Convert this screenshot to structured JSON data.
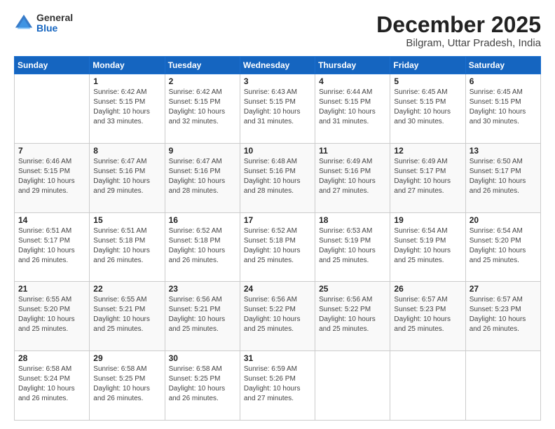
{
  "logo": {
    "general": "General",
    "blue": "Blue"
  },
  "title": "December 2025",
  "subtitle": "Bilgram, Uttar Pradesh, India",
  "days_of_week": [
    "Sunday",
    "Monday",
    "Tuesday",
    "Wednesday",
    "Thursday",
    "Friday",
    "Saturday"
  ],
  "weeks": [
    [
      {
        "day": "",
        "info": ""
      },
      {
        "day": "1",
        "info": "Sunrise: 6:42 AM\nSunset: 5:15 PM\nDaylight: 10 hours\nand 33 minutes."
      },
      {
        "day": "2",
        "info": "Sunrise: 6:42 AM\nSunset: 5:15 PM\nDaylight: 10 hours\nand 32 minutes."
      },
      {
        "day": "3",
        "info": "Sunrise: 6:43 AM\nSunset: 5:15 PM\nDaylight: 10 hours\nand 31 minutes."
      },
      {
        "day": "4",
        "info": "Sunrise: 6:44 AM\nSunset: 5:15 PM\nDaylight: 10 hours\nand 31 minutes."
      },
      {
        "day": "5",
        "info": "Sunrise: 6:45 AM\nSunset: 5:15 PM\nDaylight: 10 hours\nand 30 minutes."
      },
      {
        "day": "6",
        "info": "Sunrise: 6:45 AM\nSunset: 5:15 PM\nDaylight: 10 hours\nand 30 minutes."
      }
    ],
    [
      {
        "day": "7",
        "info": "Sunrise: 6:46 AM\nSunset: 5:15 PM\nDaylight: 10 hours\nand 29 minutes."
      },
      {
        "day": "8",
        "info": "Sunrise: 6:47 AM\nSunset: 5:16 PM\nDaylight: 10 hours\nand 29 minutes."
      },
      {
        "day": "9",
        "info": "Sunrise: 6:47 AM\nSunset: 5:16 PM\nDaylight: 10 hours\nand 28 minutes."
      },
      {
        "day": "10",
        "info": "Sunrise: 6:48 AM\nSunset: 5:16 PM\nDaylight: 10 hours\nand 28 minutes."
      },
      {
        "day": "11",
        "info": "Sunrise: 6:49 AM\nSunset: 5:16 PM\nDaylight: 10 hours\nand 27 minutes."
      },
      {
        "day": "12",
        "info": "Sunrise: 6:49 AM\nSunset: 5:17 PM\nDaylight: 10 hours\nand 27 minutes."
      },
      {
        "day": "13",
        "info": "Sunrise: 6:50 AM\nSunset: 5:17 PM\nDaylight: 10 hours\nand 26 minutes."
      }
    ],
    [
      {
        "day": "14",
        "info": "Sunrise: 6:51 AM\nSunset: 5:17 PM\nDaylight: 10 hours\nand 26 minutes."
      },
      {
        "day": "15",
        "info": "Sunrise: 6:51 AM\nSunset: 5:18 PM\nDaylight: 10 hours\nand 26 minutes."
      },
      {
        "day": "16",
        "info": "Sunrise: 6:52 AM\nSunset: 5:18 PM\nDaylight: 10 hours\nand 26 minutes."
      },
      {
        "day": "17",
        "info": "Sunrise: 6:52 AM\nSunset: 5:18 PM\nDaylight: 10 hours\nand 25 minutes."
      },
      {
        "day": "18",
        "info": "Sunrise: 6:53 AM\nSunset: 5:19 PM\nDaylight: 10 hours\nand 25 minutes."
      },
      {
        "day": "19",
        "info": "Sunrise: 6:54 AM\nSunset: 5:19 PM\nDaylight: 10 hours\nand 25 minutes."
      },
      {
        "day": "20",
        "info": "Sunrise: 6:54 AM\nSunset: 5:20 PM\nDaylight: 10 hours\nand 25 minutes."
      }
    ],
    [
      {
        "day": "21",
        "info": "Sunrise: 6:55 AM\nSunset: 5:20 PM\nDaylight: 10 hours\nand 25 minutes."
      },
      {
        "day": "22",
        "info": "Sunrise: 6:55 AM\nSunset: 5:21 PM\nDaylight: 10 hours\nand 25 minutes."
      },
      {
        "day": "23",
        "info": "Sunrise: 6:56 AM\nSunset: 5:21 PM\nDaylight: 10 hours\nand 25 minutes."
      },
      {
        "day": "24",
        "info": "Sunrise: 6:56 AM\nSunset: 5:22 PM\nDaylight: 10 hours\nand 25 minutes."
      },
      {
        "day": "25",
        "info": "Sunrise: 6:56 AM\nSunset: 5:22 PM\nDaylight: 10 hours\nand 25 minutes."
      },
      {
        "day": "26",
        "info": "Sunrise: 6:57 AM\nSunset: 5:23 PM\nDaylight: 10 hours\nand 25 minutes."
      },
      {
        "day": "27",
        "info": "Sunrise: 6:57 AM\nSunset: 5:23 PM\nDaylight: 10 hours\nand 26 minutes."
      }
    ],
    [
      {
        "day": "28",
        "info": "Sunrise: 6:58 AM\nSunset: 5:24 PM\nDaylight: 10 hours\nand 26 minutes."
      },
      {
        "day": "29",
        "info": "Sunrise: 6:58 AM\nSunset: 5:25 PM\nDaylight: 10 hours\nand 26 minutes."
      },
      {
        "day": "30",
        "info": "Sunrise: 6:58 AM\nSunset: 5:25 PM\nDaylight: 10 hours\nand 26 minutes."
      },
      {
        "day": "31",
        "info": "Sunrise: 6:59 AM\nSunset: 5:26 PM\nDaylight: 10 hours\nand 27 minutes."
      },
      {
        "day": "",
        "info": ""
      },
      {
        "day": "",
        "info": ""
      },
      {
        "day": "",
        "info": ""
      }
    ]
  ]
}
